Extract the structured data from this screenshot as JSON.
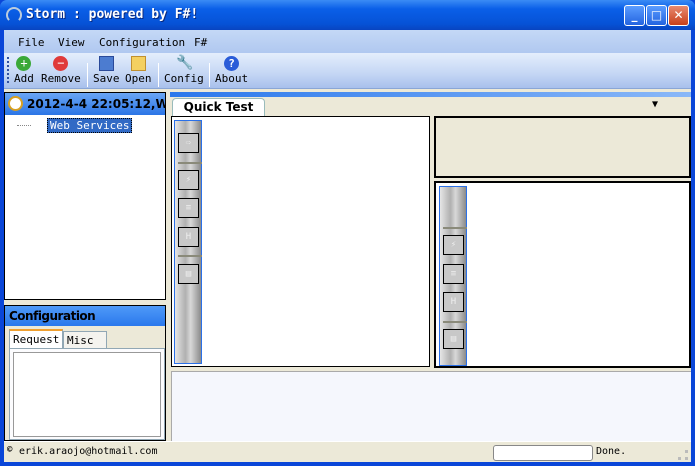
{
  "window": {
    "title": "Storm : powered by F#!",
    "minimize": "_",
    "maximize": "□",
    "close": "✕"
  },
  "menu": [
    {
      "label": "File"
    },
    {
      "label": "View"
    },
    {
      "label": "Configuration"
    },
    {
      "label": "F#"
    }
  ],
  "toolbar": {
    "add": "Add",
    "remove": "Remove",
    "save": "Save",
    "open": "Open",
    "config": "Config",
    "about": "About"
  },
  "tree": {
    "root": "2012-4-4 22:05:12,W...",
    "child": "Web Services"
  },
  "config": {
    "title": "Configuration",
    "tabs": [
      "Request",
      "Misc"
    ]
  },
  "main": {
    "tab": "Quick Test",
    "menu_icon": "▼"
  },
  "status": {
    "email": "erik.araojo@hotmail.com",
    "state": "Done.",
    "copyright": "©"
  },
  "colors": {
    "titlebar": "#0a5fe8",
    "selection": "#316ac5",
    "accent": "#2a78ec"
  }
}
